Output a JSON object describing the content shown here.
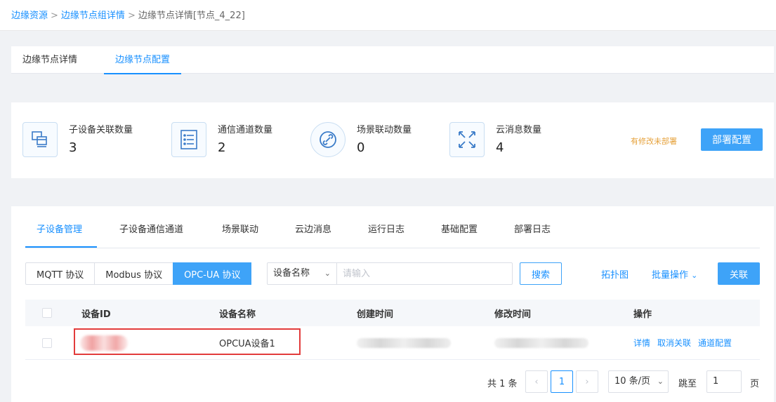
{
  "breadcrumb": {
    "items": [
      "边缘资源",
      "边缘节点组详情",
      "边缘节点详情[节点_4_22]"
    ],
    "separator": ">"
  },
  "top_tabs": [
    {
      "label": "边缘节点详情",
      "active": false
    },
    {
      "label": "边缘节点配置",
      "active": true
    }
  ],
  "stats": [
    {
      "label": "子设备关联数量",
      "value": "3",
      "icon": "device-stack-icon"
    },
    {
      "label": "通信通道数量",
      "value": "2",
      "icon": "list-icon"
    },
    {
      "label": "场景联动数量",
      "value": "0",
      "icon": "link-icon"
    },
    {
      "label": "云消息数量",
      "value": "4",
      "icon": "arrows-icon"
    }
  ],
  "deploy": {
    "unsaved_text": "有修改未部署",
    "button_label": "部署配置"
  },
  "sub_tabs": [
    {
      "label": "子设备管理",
      "active": true
    },
    {
      "label": "子设备通信通道",
      "active": false
    },
    {
      "label": "场景联动",
      "active": false
    },
    {
      "label": "云边消息",
      "active": false
    },
    {
      "label": "运行日志",
      "active": false
    },
    {
      "label": "基础配置",
      "active": false
    },
    {
      "label": "部署日志",
      "active": false
    }
  ],
  "protocols": [
    {
      "label": "MQTT 协议",
      "active": false
    },
    {
      "label": "Modbus 协议",
      "active": false
    },
    {
      "label": "OPC-UA 协议",
      "active": true
    }
  ],
  "search": {
    "field_label": "设备名称",
    "placeholder": "请输入",
    "value": "",
    "button_label": "搜索"
  },
  "toolbar": {
    "topology_label": "拓扑图",
    "batch_label": "批量操作",
    "associate_label": "关联"
  },
  "table": {
    "columns": [
      "设备ID",
      "设备名称",
      "创建时间",
      "修改时间",
      "操作"
    ],
    "rows": [
      {
        "device_name": "OPCUA设备1",
        "actions": [
          "详情",
          "取消关联",
          "通道配置"
        ]
      }
    ]
  },
  "pagination": {
    "total_label": "共 1 条",
    "current_page": "1",
    "page_size_label": "10 条/页",
    "jump_label": "跳至",
    "jump_value": "1",
    "page_suffix": "页"
  },
  "colors": {
    "primary": "#1890ff",
    "button_fill": "#3ea3f8",
    "warning": "#e6a23c",
    "highlight": "#e23b3b"
  }
}
